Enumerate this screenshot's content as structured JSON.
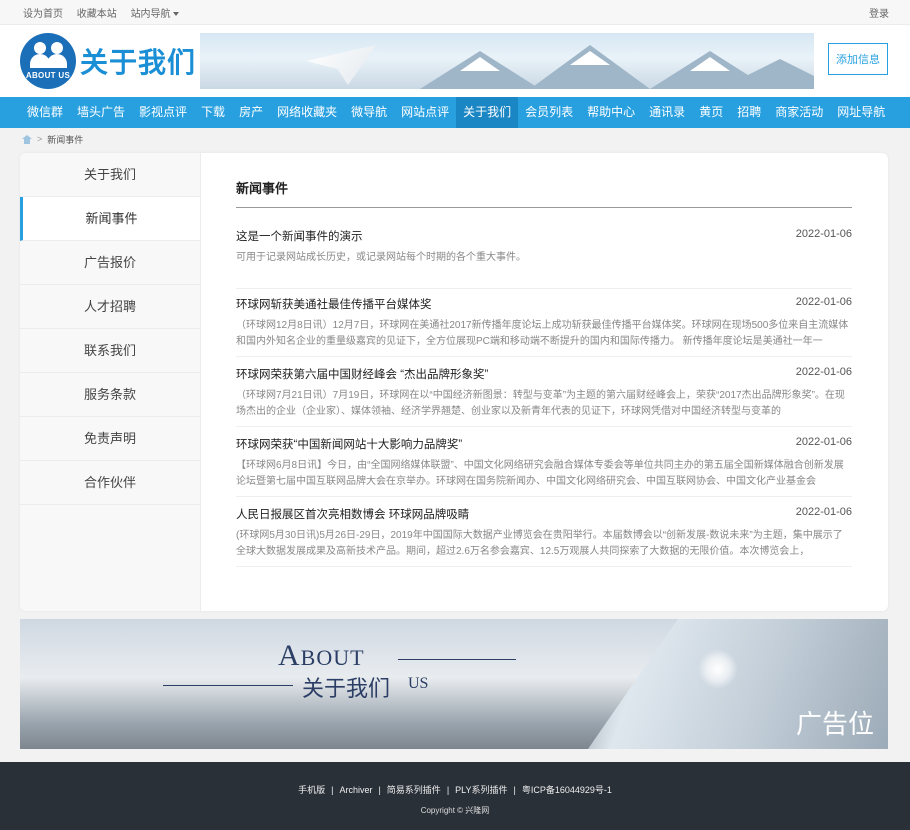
{
  "topbar": {
    "links": [
      "设为首页",
      "收藏本站",
      "站内导航"
    ],
    "login": "登录"
  },
  "header": {
    "logo_badge": "ABOUT US",
    "logo_text": "关于我们",
    "add_button": "添加信息"
  },
  "nav": {
    "items": [
      "微信群",
      "墙头广告",
      "影视点评",
      "下载",
      "房产",
      "网络收藏夹",
      "微导航",
      "网站点评",
      "关于我们",
      "会员列表",
      "帮助中心",
      "通讯录",
      "黄页",
      "招聘",
      "商家活动",
      "网址导航"
    ],
    "active_index": 8
  },
  "breadcrumb": {
    "separator": ">",
    "current": "新闻事件"
  },
  "sidebar": {
    "items": [
      "关于我们",
      "新闻事件",
      "广告报价",
      "人才招聘",
      "联系我们",
      "服务条款",
      "免责声明",
      "合作伙伴"
    ],
    "active_index": 1
  },
  "content": {
    "title": "新闻事件",
    "news": [
      {
        "title": "这是一个新闻事件的演示",
        "date": "2022-01-06",
        "summary": "可用于记录网站成长历史，或记录网站每个时期的各个重大事件。"
      },
      {
        "title": "环球网斩获美通社最佳传播平台媒体奖",
        "date": "2022-01-06",
        "summary": "（环球网12月8日讯）12月7日，环球网在美通社2017新传播年度论坛上成功斩获最佳传播平台媒体奖。环球网在现场500多位来自主流媒体和国内外知名企业的重量级嘉宾的见证下，全方位展现PC端和移动端不断提升的国内和国际传播力。 新传播年度论坛是美通社一年一"
      },
      {
        "title": "环球网荣获第六届中国财经峰会 “杰出品牌形象奖”",
        "date": "2022-01-06",
        "summary": "（环球网7月21日讯）7月19日，环球网在以“中国经济新图景：转型与变革”为主题的第六届财经峰会上，荣获“2017杰出品牌形象奖”。在现场杰出的企业（企业家）、媒体领袖、经济学界翘楚、创业家以及新青年代表的见证下，环球网凭借对中国经济转型与变革的"
      },
      {
        "title": "环球网荣获“中国新闻网站十大影响力品牌奖”",
        "date": "2022-01-06",
        "summary": "【环球网6月8日讯】今日，由“全国网络媒体联盟”、中国文化网络研究会融合媒体专委会等单位共同主办的第五届全国新媒体融合创新发展论坛暨第七届中国互联网品牌大会在京举办。环球网在国务院新闻办、中国文化网络研究会、中国互联网协会、中国文化产业基金会"
      },
      {
        "title": "人民日报展区首次亮相数博会 环球网品牌吸睛",
        "date": "2022-01-06",
        "summary": "(环球网5月30日讯)5月26日-29日，2019年中国国际大数据产业博览会在贵阳举行。本届数博会以“创新发展-数说未来”为主题，集中展示了全球大数据发展成果及高新技术产品。期间，超过2.6万名参会嘉宾、12.5万观展人共同探索了大数据的无限价值。本次博览会上，"
      }
    ]
  },
  "ad": {
    "about_first": "A",
    "about_rest": "BOUT",
    "cn": "关于我们",
    "us": "US",
    "label": "广告位"
  },
  "footer": {
    "links": [
      "手机版",
      "Archiver",
      "简易系列插件",
      "PLY系列插件",
      "粤ICP备16044929号-1"
    ],
    "copyright": "Copyright © 兴隆网"
  },
  "colors": {
    "accent": "#28a0e0",
    "nav_active": "#1a86c4",
    "footer_bg": "#2a3038"
  }
}
